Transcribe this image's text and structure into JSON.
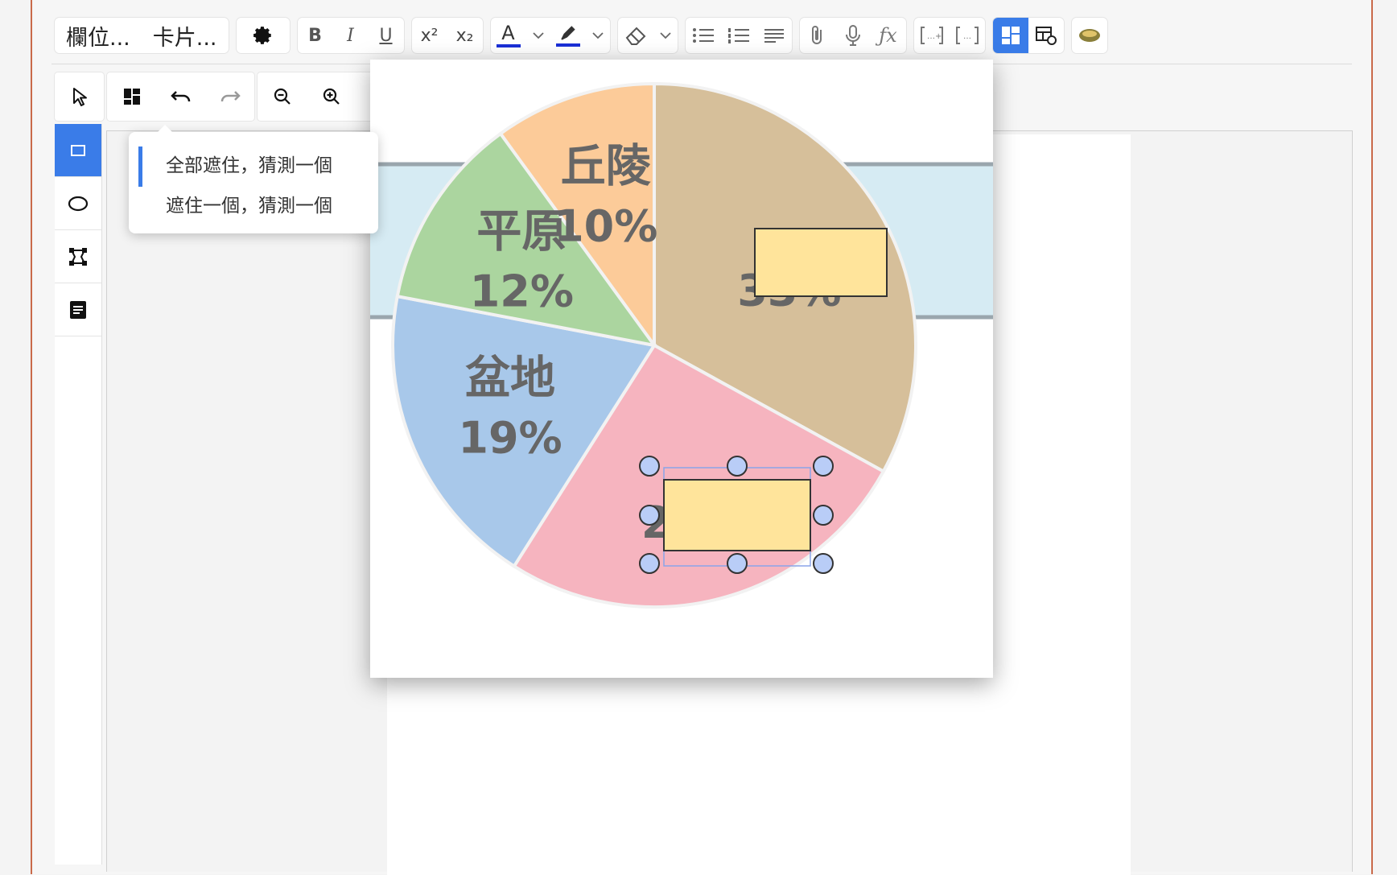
{
  "editor_toolbar": {
    "fields_button": "欄位...",
    "cards_button": "卡片...",
    "gear_icon": "gear-icon",
    "bold": "B",
    "italic": "I",
    "underline": "U",
    "superscript": "x²",
    "subscript": "x₂",
    "text_color": "A",
    "text_color_value": "#1a2fd6",
    "highlight_color_value": "#1a2fd6",
    "caret": "⌄"
  },
  "occlusion_toolbar": {
    "tools": [
      "select-icon",
      "masks-icon",
      "undo-icon",
      "redo-icon",
      "zoom-out-icon",
      "zoom-in-icon",
      "zoom-fit-icon",
      "toggle-masks-icon",
      "delete-icon",
      "duplicate-icon",
      "group-icon",
      "ungroup-icon",
      "select-all-icon",
      "align-icon"
    ]
  },
  "side_tools": {
    "items": [
      "rectangle-icon",
      "ellipse-icon",
      "polygon-icon",
      "text-icon"
    ],
    "active": "rectangle-icon"
  },
  "mode_menu": {
    "items": [
      {
        "label": "全部遮住，猜測一個",
        "selected": true
      },
      {
        "label": "遮住一個，猜測一個",
        "selected": false
      }
    ]
  },
  "chart_data": {
    "type": "pie",
    "categories": [
      "丘陵",
      "(masked)",
      "(masked)",
      "盆地",
      "平原"
    ],
    "slices": [
      {
        "label": "丘陵",
        "value_label": "10%",
        "value": 10,
        "color": "#fccb99"
      },
      {
        "label": "",
        "value_label": "33%",
        "value": 33,
        "color": "#d6bf9a"
      },
      {
        "label": "",
        "value_label": "26%",
        "value": 26,
        "color": "#f6b4bf"
      },
      {
        "label": "盆地",
        "value_label": "19%",
        "value": 19,
        "color": "#a8c8ea"
      },
      {
        "label": "平原",
        "value_label": "12%",
        "value": 12,
        "color": "#abd59f"
      }
    ],
    "masks": [
      "occlusion-mask",
      "occlusion-mask-selected"
    ]
  },
  "colors": {
    "accent": "#3a7ce8",
    "mask_fill": "#ffe49b",
    "handle_fill": "#b9cdf7"
  }
}
